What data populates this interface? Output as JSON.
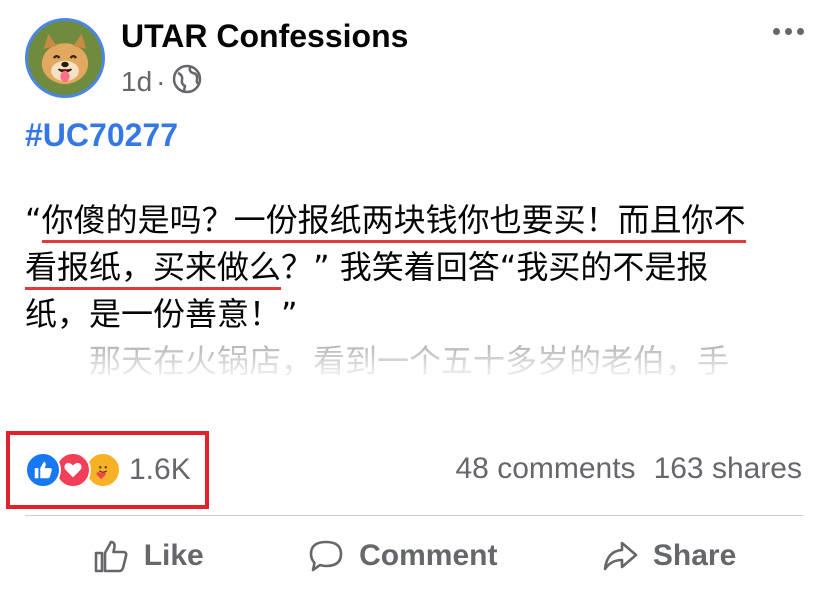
{
  "post": {
    "page_name": "UTAR Confessions",
    "time": "1d",
    "separator": "·",
    "audience_icon": "globe-icon",
    "avatar": "dog-avatar",
    "hashtag": "#UC70277",
    "body": {
      "line1_open": "“",
      "line1_underlined": "你傻的是吗？一份报纸两块钱你也要买！而且你不",
      "line2_underlined": "看报纸，买来做么",
      "line2_rest": "？” 我笑着回答“我买的不是报",
      "line3": "纸，是一份善意！”",
      "faded_line": "那天在火锅店，看到一个五十多岁的老伯，手"
    }
  },
  "engagement": {
    "reaction_icons": [
      "like-reaction-icon",
      "love-reaction-icon",
      "care-reaction-icon"
    ],
    "reaction_count": "1.6K",
    "comments": "48 comments",
    "shares": "163 shares"
  },
  "actions": {
    "like": "Like",
    "comment": "Comment",
    "share": "Share"
  },
  "colors": {
    "link_blue": "#3578e5",
    "underline_red": "#e23a3a",
    "highlight_red": "#e0222b",
    "secondary_text": "#65676b"
  }
}
